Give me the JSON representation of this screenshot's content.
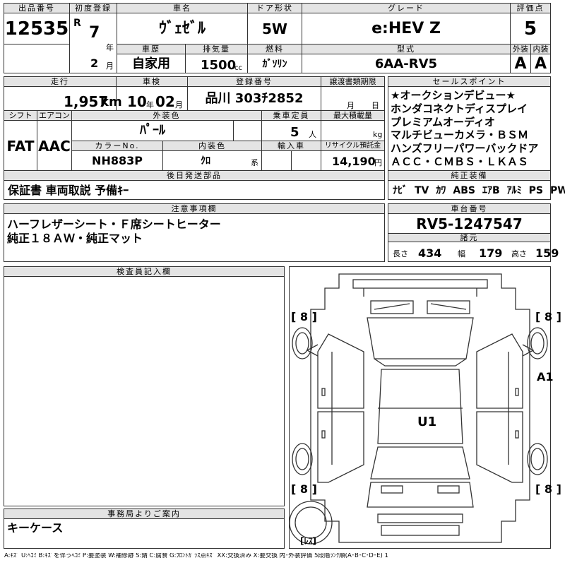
{
  "top": {
    "lot_header": "出品番号",
    "lot_value": "12535",
    "reg_header": "初度登録",
    "era": "R",
    "year": "7",
    "year_unit": "年",
    "month": "2",
    "month_unit": "月",
    "name_header": "車名",
    "name_value": "ｳﾞｪｾﾞﾙ",
    "door_header": "ドア形状",
    "door_value": "5W",
    "grade_header": "グレード",
    "grade_value": "e:HEV Z",
    "score_header": "評価点",
    "score_value": "5",
    "history_header": "車歴",
    "history_value": "自家用",
    "disp_header": "排気量",
    "disp_value": "1500",
    "disp_unit": "cc",
    "fuel_header": "燃料",
    "fuel_value": "ｶﾞｿﾘﾝ",
    "model_header": "型式",
    "model_value": "6AA-RV5",
    "ext_header": "外装",
    "ext_value": "A",
    "int_header": "内装",
    "int_value": "A"
  },
  "row2": {
    "mileage_header": "走行",
    "mileage_value": "1,957",
    "mileage_unit": "km",
    "inspection_header": "車検",
    "inspection_year": "10",
    "inspection_year_unit": "年",
    "inspection_month": "02",
    "inspection_month_unit": "月",
    "plate_header": "登録番号",
    "plate_value": "品川 303ﾁ2852",
    "transfer_header": "譲渡書類期限",
    "transfer_month_unit": "月",
    "transfer_day_unit": "日",
    "shift_header": "シフト",
    "shift_value": "FAT",
    "ac_header": "エアコン",
    "ac_value": "AAC",
    "color_header": "外装色",
    "color_value": "ﾊﾟｰﾙ",
    "capacity_header": "乗車定員",
    "capacity_value": "5",
    "capacity_unit": "人",
    "load_header": "最大積載量",
    "load_unit": "kg",
    "colorno_header": "カラーNo.",
    "colorno_value": "NH883P",
    "interior_header": "内装色",
    "interior_value": "ｸﾛ",
    "interior_unit": "系",
    "import_header": "輸入車",
    "recycle_header": "リサイクル預託金",
    "recycle_value": "14,190",
    "recycle_unit": "円"
  },
  "sales": {
    "header": "セールスポイント",
    "lines": [
      "★オークションデビュー★",
      "ホンダコネクトディスプレイ",
      "プレミアムオーディオ",
      "マルチビューカメラ・ＢＳＭ",
      "ハンズフリーパワーバックドア",
      "ＡＣＣ・ＣＭＢＳ・ＬＫＡＳ"
    ]
  },
  "later": {
    "header": "後日発送部品",
    "value": "保証書 車両取説 予備ｷｰ"
  },
  "equip": {
    "header": "純正装備",
    "items": [
      "ﾅﾋﾞ",
      "TV",
      "ｶﾜ",
      "ABS",
      "ｴｱB",
      "ｱﾙﾐ",
      "PS",
      "PW"
    ]
  },
  "notes": {
    "header": "注意事項欄",
    "lines": [
      "ハーフレザーシート・Ｆ席シートヒーター",
      "純正１８ＡＷ・純正マット"
    ]
  },
  "chassis": {
    "header": "車台番号",
    "value": "RV5-1247547",
    "dims_header": "諸元",
    "length_label": "長さ",
    "length_value": "434",
    "width_label": "幅",
    "width_value": "179",
    "height_label": "高さ",
    "height_value": "159"
  },
  "inspector": {
    "header": "検査員記入欄"
  },
  "diagram": {
    "tire_fl": "[ 8 ]",
    "tire_fr": "[ 8 ]",
    "tire_rl": "[ 8 ]",
    "tire_rr": "[ 8 ]",
    "mark_a1": "A1",
    "mark_u1": "U1",
    "spare": "[ﾚｽ]"
  },
  "office": {
    "header": "事務局よりご案内",
    "value": "キーケース"
  },
  "legend": "A:ｷｽﾞ U:ﾍｺﾐ B:ｷｽﾞを伴うﾍｺﾐ P:要塗装 W:補修跡 S:錆 C:腐食 G:ﾌﾛﾝﾄｶﾞﾗｽ点ｷｽﾞ XX:交換済み X:要交換 内･外装評価 5段階ﾗﾝｸ順(A･B･C･D･E) 1"
}
